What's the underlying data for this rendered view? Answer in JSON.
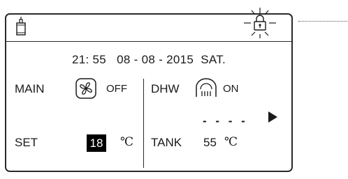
{
  "header": {
    "compressor_icon": "compressor-icon",
    "lock_icon": "lock-icon"
  },
  "status": {
    "time": "21: 55",
    "date": "08 - 08 - 2015",
    "weekday": "SAT."
  },
  "main": {
    "label": "MAIN",
    "icon": "fan-icon",
    "state": "OFF"
  },
  "dhw": {
    "label": "DHW",
    "icon": "shower-icon",
    "state": "ON",
    "placeholder": "- - - -"
  },
  "set": {
    "label": "SET",
    "value": "18",
    "unit": "℃"
  },
  "tank": {
    "label": "TANK",
    "value": "55",
    "unit": "℃"
  },
  "nav": {
    "next_icon": "arrow-right-icon"
  },
  "colors": {
    "border": "#2a2a2a",
    "highlight_bg": "#000000",
    "highlight_fg": "#ffffff"
  }
}
